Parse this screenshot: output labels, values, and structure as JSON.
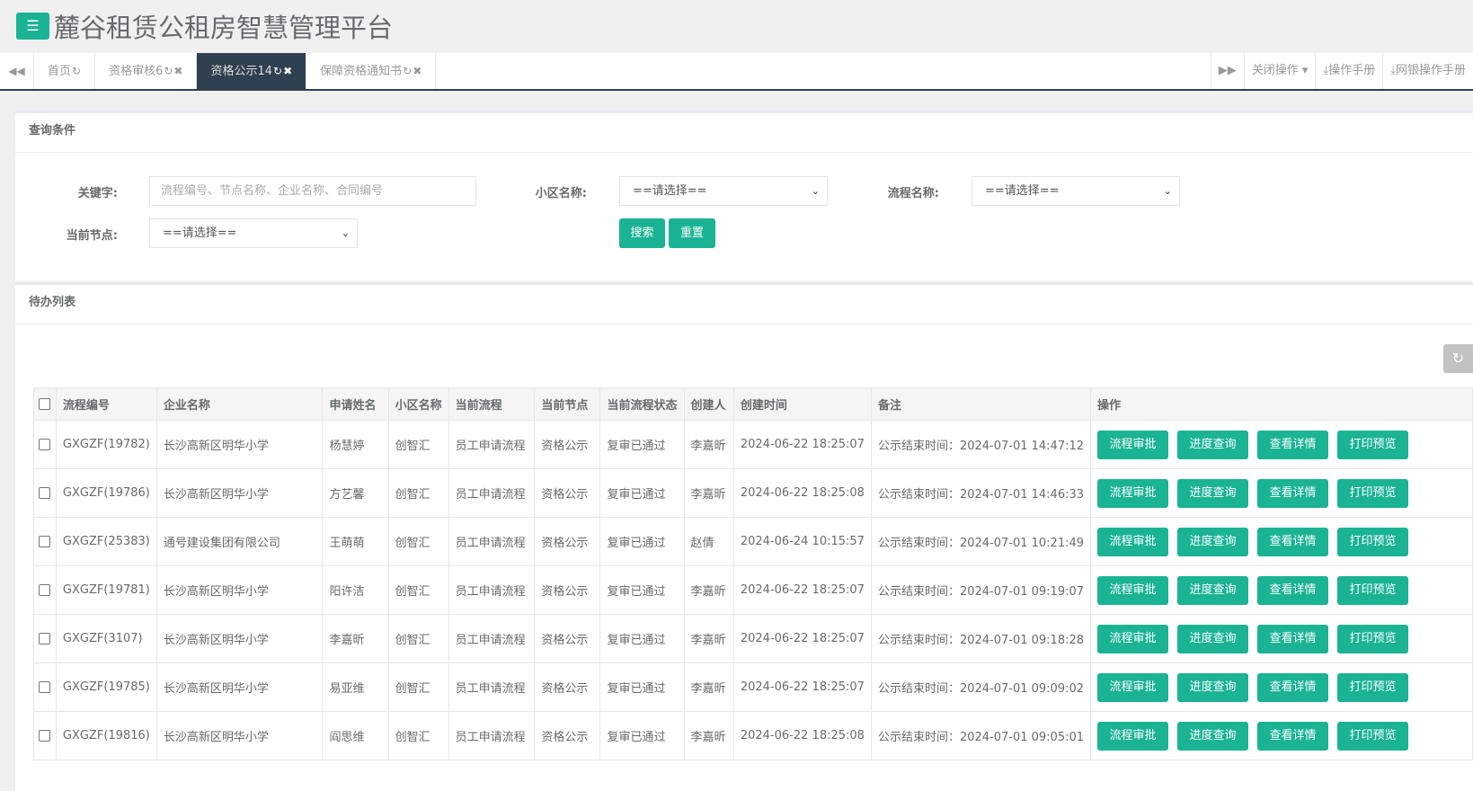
{
  "header": {
    "title": "麓谷租赁公租房智慧管理平台",
    "menu_icon": "hamburger-icon"
  },
  "tabs": [
    {
      "label": "首页",
      "refresh": "↻",
      "close": ""
    },
    {
      "label": "资格审核6",
      "refresh": "↻",
      "close": "✖"
    },
    {
      "label": "资格公示14",
      "refresh": "↻",
      "close": "✖",
      "active": true
    },
    {
      "label": "保障资格通知书",
      "refresh": "↻",
      "close": "✖"
    }
  ],
  "tabs_right": {
    "close_ops": "关闭操作",
    "manual": "操作手册",
    "bank_manual": "网银操作手册"
  },
  "query": {
    "title": "查询条件",
    "keyword_label": "关键字:",
    "keyword_placeholder": "流程编号、节点名称、企业名称、合同编号",
    "community_label": "小区名称:",
    "community_value": "==请选择==",
    "process_label": "流程名称:",
    "process_value": "==请选择==",
    "node_label": "当前节点:",
    "node_value": "==请选择==",
    "search_btn": "搜索",
    "reset_btn": "重置"
  },
  "list": {
    "title": "待办列表",
    "columns": [
      "流程编号",
      "企业名称",
      "申请姓名",
      "小区名称",
      "当前流程",
      "当前节点",
      "当前流程状态",
      "创建人",
      "创建时间",
      "备注",
      "操作"
    ],
    "actions": [
      "流程审批",
      "进度查询",
      "查看详情",
      "打印预览"
    ],
    "rows": [
      [
        "GXGZF(19782)",
        "长沙高新区明华小学",
        "杨慧婷",
        "创智汇",
        "员工申请流程",
        "资格公示",
        "复审已通过",
        "李嘉昕",
        "2024-06-22 18:25:07",
        "公示结束时间：2024-07-01 14:47:12"
      ],
      [
        "GXGZF(19786)",
        "长沙高新区明华小学",
        "方艺馨",
        "创智汇",
        "员工申请流程",
        "资格公示",
        "复审已通过",
        "李嘉昕",
        "2024-06-22 18:25:08",
        "公示结束时间：2024-07-01 14:46:33"
      ],
      [
        "GXGZF(25383)",
        "通号建设集团有限公司",
        "王萌萌",
        "创智汇",
        "员工申请流程",
        "资格公示",
        "复审已通过",
        "赵倩",
        "2024-06-24 10:15:57",
        "公示结束时间：2024-07-01 10:21:49"
      ],
      [
        "GXGZF(19781)",
        "长沙高新区明华小学",
        "阳许洁",
        "创智汇",
        "员工申请流程",
        "资格公示",
        "复审已通过",
        "李嘉昕",
        "2024-06-22 18:25:07",
        "公示结束时间：2024-07-01 09:19:07"
      ],
      [
        "GXGZF(3107)",
        "长沙高新区明华小学",
        "李嘉昕",
        "创智汇",
        "员工申请流程",
        "资格公示",
        "复审已通过",
        "李嘉昕",
        "2024-06-22 18:25:07",
        "公示结束时间：2024-07-01 09:18:28"
      ],
      [
        "GXGZF(19785)",
        "长沙高新区明华小学",
        "易亚维",
        "创智汇",
        "员工申请流程",
        "资格公示",
        "复审已通过",
        "李嘉昕",
        "2024-06-22 18:25:07",
        "公示结束时间：2024-07-01 09:09:02"
      ],
      [
        "GXGZF(19816)",
        "长沙高新区明华小学",
        "阎思维",
        "创智汇",
        "员工申请流程",
        "资格公示",
        "复审已通过",
        "李嘉昕",
        "2024-06-22 18:25:08",
        "公示结束时间：2024-07-01 09:05:01"
      ]
    ]
  },
  "colors": {
    "accent": "#1ab394",
    "tab_active": "#2f4050"
  }
}
